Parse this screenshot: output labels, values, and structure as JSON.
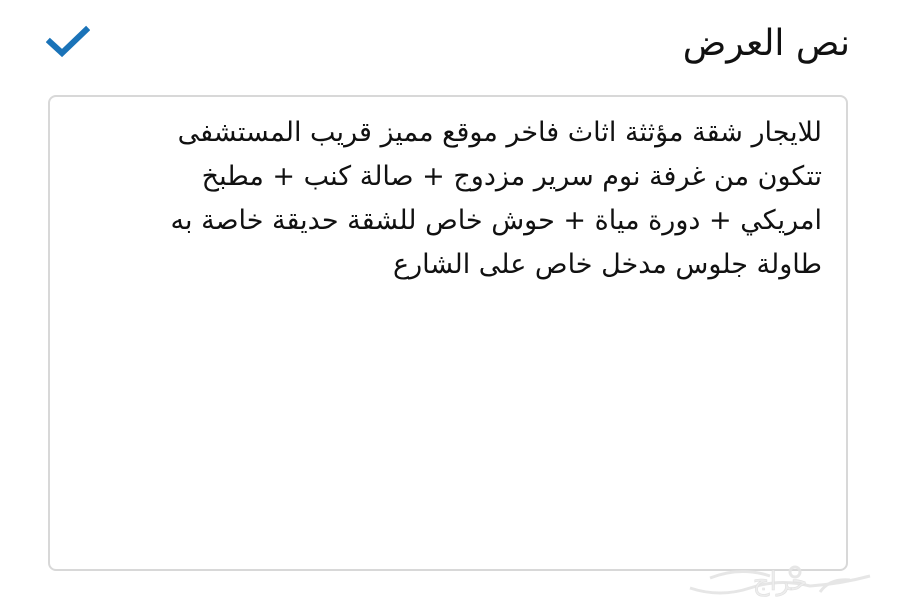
{
  "header": {
    "title": "نص العرض",
    "confirm_icon": "checkmark-icon",
    "accent_color": "#1a73b8"
  },
  "editor": {
    "text": "للايجار شقة مؤثثة اثاث فاخر موقع مميز قريب المستشفى\nتتكون من غرفة نوم سرير مزدوج + صالة كنب + مطبخ\nامريكي + دورة مياة + حوش خاص للشقة حديقة خاصة به\nطاولة جلوس مدخل خاص على الشارع"
  },
  "watermark": {
    "text": "حراج"
  }
}
